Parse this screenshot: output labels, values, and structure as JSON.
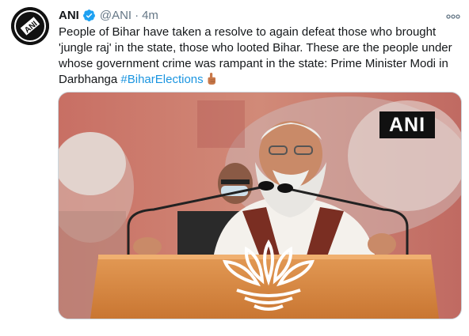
{
  "tweet": {
    "author_name": "ANI",
    "handle": "@ANI",
    "separator": "·",
    "time": "4m",
    "more_icon": "more-horizontal-icon",
    "text": "People of Bihar have taken a resolve to again defeat those who brought 'jungle raj' in the state, those who looted Bihar. These are the people under whose government crime was rampant in the state: Prime Minister Modi in Darbhanga",
    "hashtag": "#BiharElections",
    "emoji": "index-finger-pointing-up-icon",
    "avatar_text": "ANI"
  },
  "media": {
    "watermark": "ANI",
    "colors": {
      "background": "#c7776b",
      "podium": "#d9843e",
      "lotus": "#ffffff"
    }
  },
  "colors": {
    "link": "#1b95e0",
    "verified": "#1da1f2",
    "muted": "#657786"
  }
}
